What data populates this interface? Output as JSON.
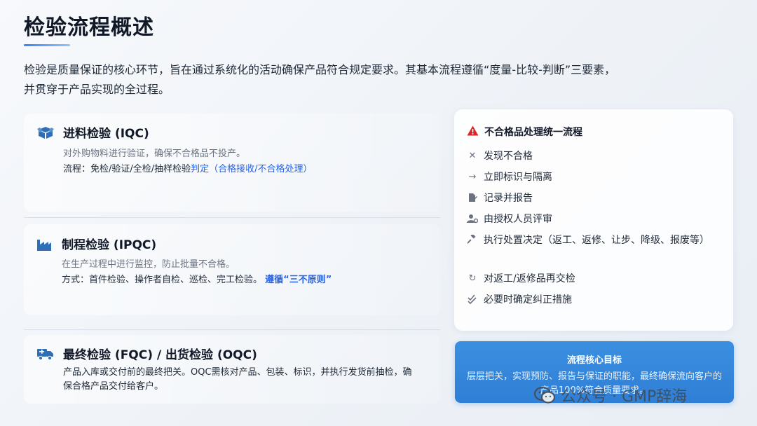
{
  "page": {
    "title": "检验流程概述",
    "intro_line1": "检验是质量保证的核心环节，旨在通过系统化的活动确保产品符合规定要求。其基本流程遵循“度量-比较-判断”三要素，",
    "intro_line2": "并贯穿于产品实现的全过程。"
  },
  "sections": {
    "iqc": {
      "name": "进料检验 (IQC)",
      "desc": "对外购物料进行验证，确保不合格品不投产。",
      "flow_prefix": "流程：免检/验证/全检/抽样检验",
      "flow_highlight": "判定（合格接收/不合格处理）",
      "icon": "box-icon"
    },
    "ipqc": {
      "name": "制程检验 (IPQC)",
      "desc": "在生产过程中进行监控，防止批量不合格。",
      "method_prefix": "方式：首件检验、操作者自检、巡检、完工检验。",
      "method_highlight": "遵循“三不原则”",
      "icon": "factory-icon"
    },
    "fqc": {
      "name": "最终检验 (FQC) / 出货检验 (OQC)",
      "desc_line1": "产品入库或交付前的最终把关。OQC需核对产品、包装、标识，并执行发货前抽检，确",
      "desc_line2": "保合格产品交付给客户。",
      "icon": "truck-icon"
    }
  },
  "panel": {
    "title": "不合格品处理统一流程",
    "title_icon": "warning-icon",
    "steps": [
      {
        "label": "发现不合格",
        "icon": "x-icon"
      },
      {
        "label": "立即标识与隔离",
        "icon": "arrow-right-icon"
      },
      {
        "label": "记录并报告",
        "icon": "document-edit-icon"
      },
      {
        "label": "由授权人员评审",
        "icon": "user-gear-icon"
      },
      {
        "label": "执行处置决定（返工、返修、让步、降级、报废等）",
        "icon": "gavel-icon"
      },
      {
        "label": "对返工/返修品再交检",
        "icon": "redo-icon"
      },
      {
        "label": "必要时确定纠正措施",
        "icon": "double-check-icon"
      }
    ]
  },
  "goal": {
    "title": "流程核心目标",
    "text": "层层把关，实现预防、报告与保证的职能，最终确保流向客户的产品100%符合质量要求。"
  },
  "watermark": {
    "text": "公众号 · GMP辞海",
    "icon": "wechat-icon"
  },
  "colors": {
    "accent": "#2563eb",
    "icon_blue": "#2f6fb8",
    "warning_red": "#dc2626",
    "goal_blue": "#3b8fe0"
  }
}
